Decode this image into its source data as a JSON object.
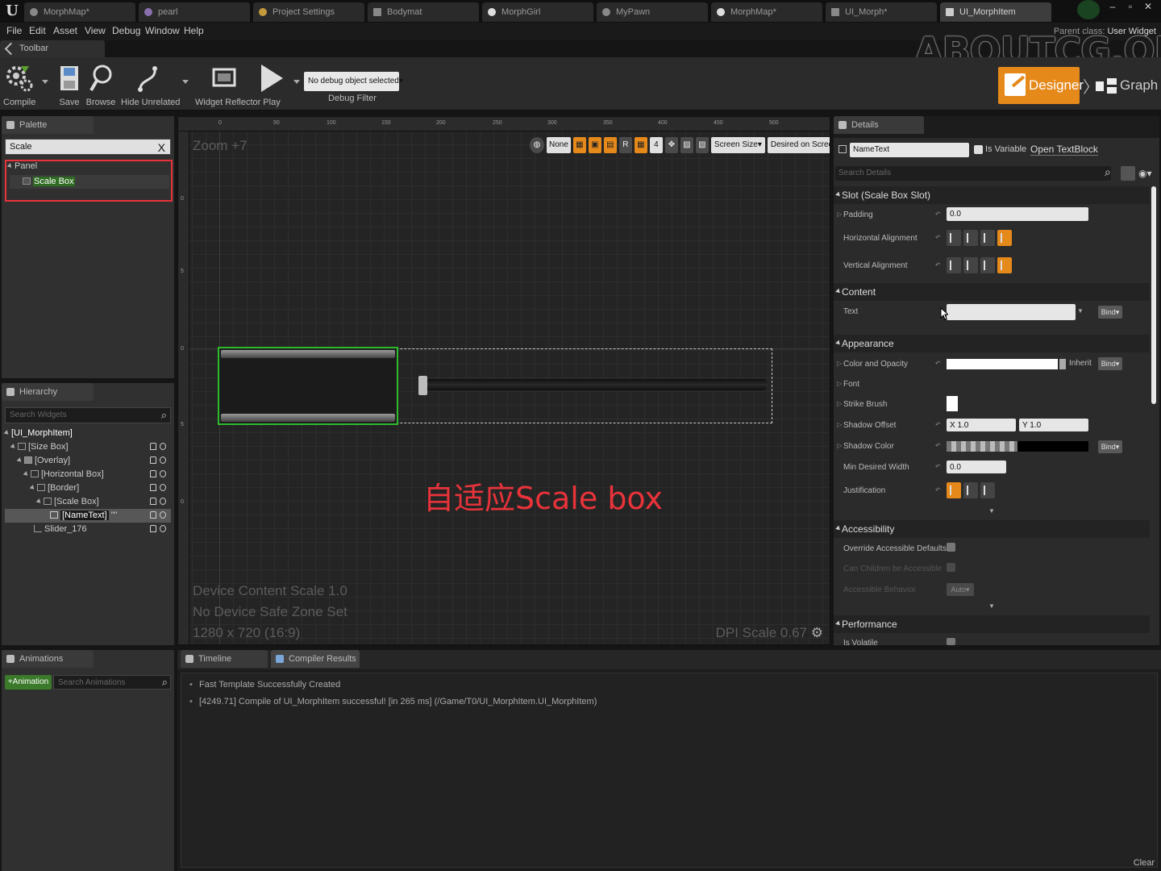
{
  "tabs": [
    "MorphMap*",
    "pearl",
    "Project Settings",
    "Bodymat",
    "MorphGirl",
    "MyPawn",
    "MorphMap*",
    "UI_Morph*",
    "UI_MorphItem"
  ],
  "menu": [
    "File",
    "Edit",
    "Asset",
    "View",
    "Debug",
    "Window",
    "Help"
  ],
  "parent_class": {
    "label": "Parent class:",
    "value": "User Widget"
  },
  "watermark": "ABOUTCG.ORG",
  "toolbar_tab": "Toolbar",
  "toolbar": {
    "compile": "Compile",
    "save": "Save",
    "browse": "Browse",
    "hide_unrelated": "Hide Unrelated",
    "widget_reflector": "Widget Reflector",
    "play": "Play",
    "debug_object": "No debug object selected▾",
    "debug_filter": "Debug Filter"
  },
  "mode": {
    "designer": "Designer",
    "graph": "Graph"
  },
  "palette": {
    "tab": "Palette",
    "search_value": "Scale",
    "clear": "X",
    "category": "Panel",
    "item": "Scale Box"
  },
  "hierarchy": {
    "tab": "Hierarchy",
    "search_placeholder": "Search Widgets",
    "rows": [
      "[UI_MorphItem]",
      "[Size Box]",
      "[Overlay]",
      "[Horizontal Box]",
      "[Border]",
      "[Scale Box]",
      "[NameText]",
      "Slider_176"
    ],
    "name_suffix": "\"\""
  },
  "canvas": {
    "zoom": "Zoom +7",
    "ruler_h": [
      "0",
      "50",
      "100",
      "150",
      "200",
      "250",
      "300",
      "350",
      "400",
      "450",
      "500"
    ],
    "ruler_v": [
      "0",
      "5",
      "0",
      "5",
      "0"
    ],
    "tools": [
      "None",
      "R",
      "4",
      "Screen Size▾",
      "Desired on Screen▾"
    ],
    "annotation": "自适应Scale box",
    "device_scale": "Device Content Scale 1.0",
    "safe_zone": "No Device Safe Zone Set",
    "resolution": "1280 x 720 (16:9)",
    "dpi": "DPI Scale 0.67"
  },
  "details": {
    "tab": "Details",
    "name_value": "NameText",
    "is_variable": "Is Variable",
    "open_link": "Open TextBlock",
    "search_placeholder": "Search Details",
    "slot_section": "Slot (Scale Box Slot)",
    "padding": "Padding",
    "padding_value": "0.0",
    "h_align": "Horizontal Alignment",
    "v_align": "Vertical Alignment",
    "content_section": "Content",
    "text": "Text",
    "bind": "Bind▾",
    "appearance_section": "Appearance",
    "color_opacity": "Color and Opacity",
    "inherit": "Inherit",
    "font": "Font",
    "strike_brush": "Strike Brush",
    "shadow_offset": "Shadow Offset",
    "shadow_x": "X 1.0",
    "shadow_y": "Y 1.0",
    "shadow_color": "Shadow Color",
    "min_width": "Min Desired Width",
    "min_width_value": "0.0",
    "justification": "Justification",
    "accessibility_section": "Accessibility",
    "override": "Override Accessible Defaults",
    "can_children": "Can Children be Accessible",
    "behavior": "Accessible Behavior",
    "behavior_value": "Auto▾",
    "performance_section": "Performance",
    "is_volatile": "Is Volatile"
  },
  "animations": {
    "tab": "Animations",
    "add": "+Animation",
    "search_placeholder": "Search Animations"
  },
  "output": {
    "tab_timeline": "Timeline",
    "tab_compiler": "Compiler Results",
    "lines": [
      "Fast Template Successfully Created",
      "[4249.71] Compile of UI_MorphItem successful! [in 265 ms] (/Game/T0/UI_MorphItem.UI_MorphItem)"
    ],
    "clear": "Clear"
  },
  "colors": {
    "accent": "#e5891b",
    "selection": "#2dbb2d",
    "palette_highlight": "#e8333a",
    "annotation": "#e8333a"
  }
}
